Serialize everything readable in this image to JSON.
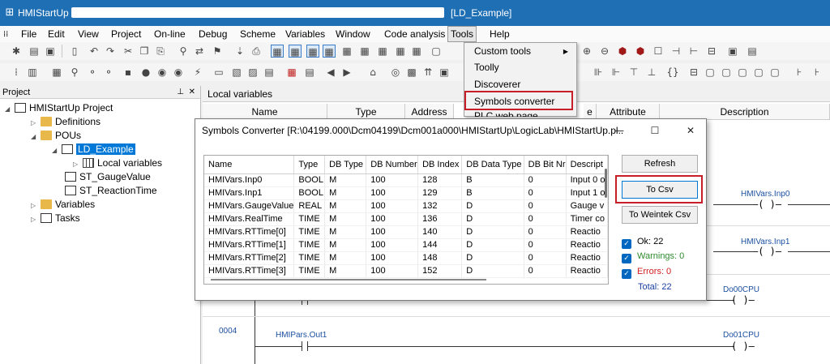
{
  "window": {
    "title_prefix": "HMIStartUp",
    "title_suffix": "[LD_Example]"
  },
  "menu": [
    "File",
    "Edit",
    "View",
    "Project",
    "On-line",
    "Debug",
    "Scheme",
    "Variables",
    "Window",
    "Code analysis",
    "Tools",
    "Help"
  ],
  "tools_menu": {
    "items": [
      "Custom tools",
      "Toolly",
      "Discoverer",
      "Symbols converter",
      "PLC web page"
    ]
  },
  "project_panel": {
    "header": "Project",
    "items": [
      {
        "label": "HMIStartUp Project"
      },
      {
        "label": "Definitions"
      },
      {
        "label": "POUs"
      },
      {
        "label": "LD_Example"
      },
      {
        "label": "Local variables"
      },
      {
        "label": "ST_GaugeValue"
      },
      {
        "label": "ST_ReactionTime"
      },
      {
        "label": "Variables"
      },
      {
        "label": "Tasks"
      }
    ]
  },
  "editor": {
    "tab": "Local variables",
    "columns": [
      "Name",
      "Type",
      "Address",
      "e",
      "Attribute",
      "Description"
    ],
    "rungs": [
      {
        "coil": "HMIVars.Inp0"
      },
      {
        "coil": "HMIVars.Inp1"
      },
      {
        "coil": "Do00CPU"
      },
      {
        "number": "0004",
        "contact": "HMIPars.Out1",
        "coil": "Do01CPU"
      }
    ]
  },
  "dialog": {
    "title": "Symbols Converter [R:\\04199.000\\Dcm04199\\Dcm001a000\\HMIStartUp\\LogicLab\\HMIStartUp.pl...",
    "columns": [
      "Name",
      "Type",
      "DB Type",
      "DB Number",
      "DB Index",
      "DB Data Type",
      "DB Bit Nr",
      "Descript"
    ],
    "rows": [
      [
        "HMIVars.Inp0",
        "BOOL",
        "M",
        "100",
        "128",
        "B",
        "0",
        "Input 0 o"
      ],
      [
        "HMIVars.Inp1",
        "BOOL",
        "M",
        "100",
        "129",
        "B",
        "0",
        "Input 1 o"
      ],
      [
        "HMIVars.GaugeValue",
        "REAL",
        "M",
        "100",
        "132",
        "D",
        "0",
        "Gauge v"
      ],
      [
        "HMIVars.RealTime",
        "TIME",
        "M",
        "100",
        "136",
        "D",
        "0",
        "Timer co"
      ],
      [
        "HMIVars.RTTime[0]",
        "TIME",
        "M",
        "100",
        "140",
        "D",
        "0",
        "Reactio"
      ],
      [
        "HMIVars.RTTime[1]",
        "TIME",
        "M",
        "100",
        "144",
        "D",
        "0",
        "Reactio"
      ],
      [
        "HMIVars.RTTime[2]",
        "TIME",
        "M",
        "100",
        "148",
        "D",
        "0",
        "Reactio"
      ],
      [
        "HMIVars.RTTime[3]",
        "TIME",
        "M",
        "100",
        "152",
        "D",
        "0",
        "Reactio"
      ]
    ],
    "buttons": {
      "refresh": "Refresh",
      "to_csv": "To Csv",
      "to_weintek": "To Weintek Csv"
    },
    "status": {
      "ok": "Ok: 22",
      "warnings": "Warnings: 0",
      "errors": "Errors: 0",
      "total": "Total: 22"
    }
  },
  "colors": {
    "highlight": "#c81e28",
    "titlebar": "#1f6fb5",
    "ok": "#000000",
    "warnings": "#2e8b2e",
    "errors": "#d02020",
    "total": "#1a3fa0"
  }
}
